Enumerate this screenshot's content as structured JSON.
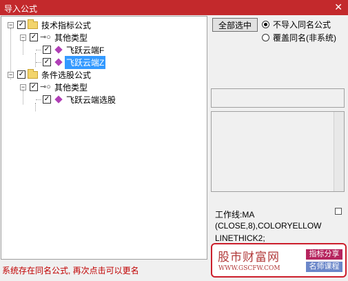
{
  "window": {
    "title": "导入公式",
    "close_glyph": "✕"
  },
  "tree": {
    "nodes": [
      {
        "label": "技术指标公式",
        "icon": "folder-icon",
        "expander": "−",
        "checked": "✓"
      },
      {
        "label": "其他类型",
        "icon": "key-icon",
        "expander": "−",
        "checked": "✓"
      },
      {
        "label": "飞跃云端F",
        "icon": "formula-icon",
        "checked": "✓"
      },
      {
        "label": "飞跃云端Z",
        "icon": "formula-icon",
        "checked": "✓",
        "selected": true
      },
      {
        "label": "条件选股公式",
        "icon": "folder-icon",
        "expander": "−",
        "checked": "✓"
      },
      {
        "label": "其他类型",
        "icon": "key-icon",
        "expander": "−",
        "checked": "✓"
      },
      {
        "label": "飞跃云端选股",
        "icon": "formula-icon",
        "checked": "✓"
      }
    ]
  },
  "options": {
    "select_all_label": "全部选中",
    "radio_no_import": "不导入同名公式",
    "radio_overwrite": "覆盖同名(非系统)",
    "selected_radio": "no_import"
  },
  "code_preview": {
    "lines": [
      "工作线:MA",
      "(CLOSE,8),COLORYELLOW",
      "LINETHICK2;"
    ]
  },
  "status_text": "系统存在同名公式, 再次点击可以更名",
  "watermark": {
    "name": "股市财富网",
    "url": "WWW.GSCFW.COM",
    "tag1": "指标分享",
    "tag2": "名师课程"
  },
  "colors": {
    "titlebar": "#c3292c",
    "selection": "#3399ff",
    "status": "#c00000"
  }
}
